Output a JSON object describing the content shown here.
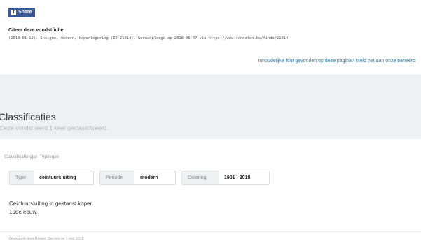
{
  "share": {
    "icon": "facebook-icon",
    "label": "Share",
    "color": "#3b5998"
  },
  "citation": {
    "title": "Citeer deze vondstfiche",
    "text": "(2018-01-12). Insigne, modern, koperlegering (ID-21814). Geraadpleegd op 2018-06-07 via https://www.vondsten.be/finds/21814"
  },
  "report_link": "Inhoudelijke fout gevonden op deze pagina? Meld het aan onze beheerd",
  "classifications": {
    "title": "Classificaties",
    "subtitle": "Deze vondst werd 1 keer geclassificeerd.",
    "type_caption": "Classificatietype: Typologie",
    "tags": [
      {
        "key": "Type",
        "value": "ceintuursluiting"
      },
      {
        "key": "Periode",
        "value": "modern"
      },
      {
        "key": "Datering",
        "value": "1901 - 2018"
      }
    ],
    "description": [
      "Ceintuursluiting in gestanst koper.",
      "19de eeuw."
    ],
    "footer": "Opgesteld door Roland Decock op 1 mei 2018"
  },
  "colors": {
    "accent_link": "#2a7ab0",
    "band_bg": "#eef1f4"
  }
}
